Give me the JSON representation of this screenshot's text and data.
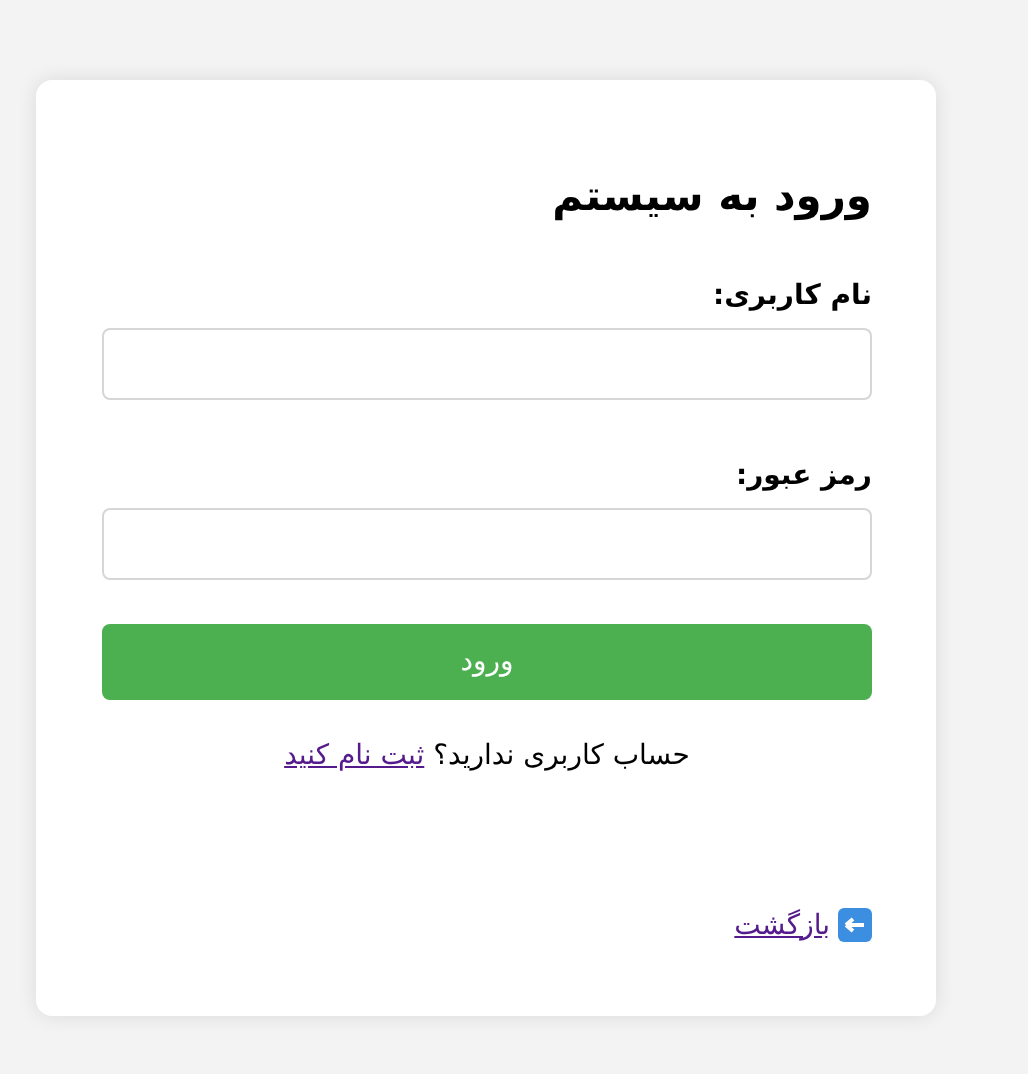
{
  "title": "ورود به سیستم",
  "fields": [
    {
      "label": "نام کاربری:"
    },
    {
      "label": "رمز عبور:"
    }
  ],
  "submit_button": "ورود",
  "signup": {
    "text": "حساب کاربری ندارید؟",
    "link": "ثبت نام کنید"
  },
  "back_link": {
    "label": "بازگشت"
  }
}
